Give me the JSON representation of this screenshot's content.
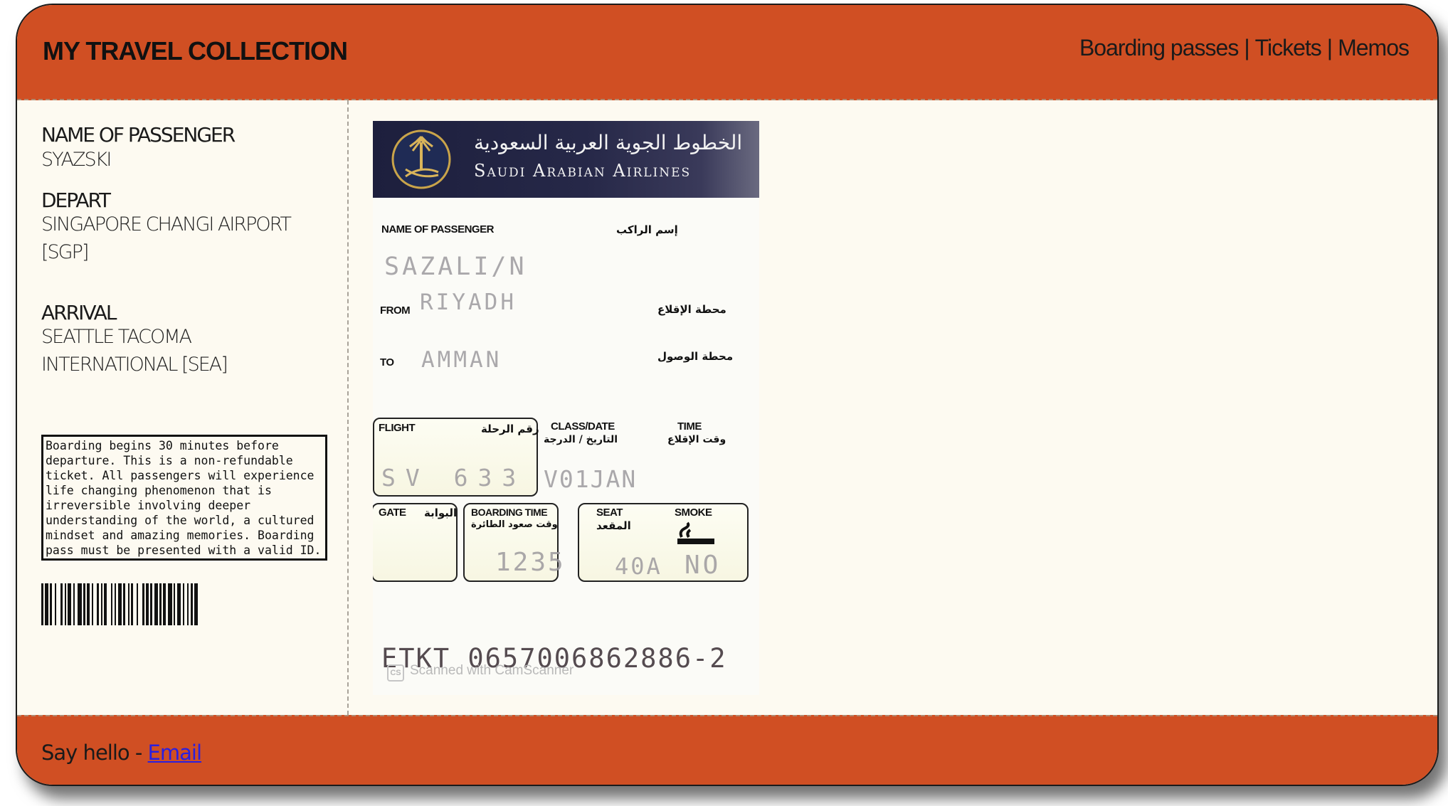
{
  "header": {
    "brand": "MY TRAVEL COLLECTION",
    "nav": [
      {
        "label": "Boarding passes"
      },
      {
        "label": "Tickets"
      },
      {
        "label": "Memos"
      }
    ],
    "separator": "|"
  },
  "sidebar": {
    "passenger_label": "NAME OF PASSENGER",
    "passenger_value": "SYAZSKI",
    "depart_label": "DEPART",
    "depart_value": "SINGAPORE CHANGI AIRPORT [SGP]",
    "arrival_label": "ARRIVAL",
    "arrival_value": "SEATTLE TACOMA INTERNATIONAL [SEA]",
    "notice": "Boarding begins 30 minutes before departure. This is a non-refundable ticket. All passengers will experience life changing phenomenon that is irreversible involving deeper understanding of the world, a cultured mindset and amazing memories. Boarding pass must be presented with a valid ID."
  },
  "ticket": {
    "airline_arabic": "الخطوط الجوية العربية السعودية",
    "airline_name": "Saudi Arabian Airlines",
    "name_label": "NAME OF PASSENGER",
    "name_label_ar": "إسم الراكب",
    "passenger": "SAZALI/N",
    "from_label": "FROM",
    "from_label_ar": "محطة الإقلاع",
    "from_value": "RIYADH",
    "to_label": "TO",
    "to_label_ar": "محطة الوصول",
    "to_value": "AMMAN",
    "flight_label": "FLIGHT",
    "flight_label_ar": "رقم الرحلة",
    "flight_value": "SV 633",
    "class_label": "CLASS/DATE",
    "class_label_ar": "التاريخ / الدرجة",
    "class_value": "V01JAN",
    "time_label": "TIME",
    "time_label_ar": "وقت الإقلاع",
    "gate_label": "GATE",
    "gate_label_ar": "البوابة",
    "boarding_label": "BOARDING TIME",
    "boarding_label_ar": "وقت صعود الطائرة",
    "boarding_value": "1235",
    "seat_label": "SEAT",
    "seat_label_ar": "المقعد",
    "seat_value": "40A",
    "smoke_label": "SMOKE",
    "smoke_value": "NO",
    "etkt": "ETKT 0657006862886-2",
    "scanner": "Scanned with CamScanner",
    "scanner_logo": "CS"
  },
  "footer": {
    "hello": "Say hello - ",
    "email_label": "Email"
  },
  "colors": {
    "accent": "#d04f23",
    "card_bg": "#fdfaf1",
    "link": "#2a1fe0"
  }
}
